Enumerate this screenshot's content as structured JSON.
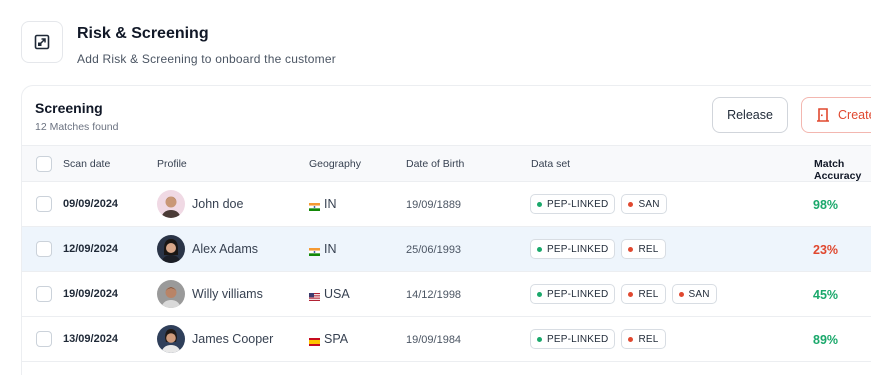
{
  "header": {
    "title": "Risk & Screening",
    "subtitle": "Add Risk & Screening to onboard the customer",
    "icon": "external-link-icon"
  },
  "screening": {
    "title": "Screening",
    "count_text": "12 Matches found",
    "release_label": "Release",
    "create_label": "Create",
    "create_icon": "door-icon",
    "accent_color": "#e0482f",
    "columns": [
      "Scan date",
      "Profile",
      "Geography",
      "Date of Birth",
      "Data set",
      "Match Accuracy"
    ],
    "rows": [
      {
        "scan_date": "09/09/2024",
        "name": "John doe",
        "geo": "IN",
        "flag": "india-flag",
        "dob": "19/09/1889",
        "datasets": [
          "PEP-LINKED",
          "SAN"
        ],
        "accuracy": "98%",
        "accuracy_status": "good",
        "selected": false
      },
      {
        "scan_date": "12/09/2024",
        "name": "Alex Adams",
        "geo": "IN",
        "flag": "india-flag",
        "dob": "25/06/1993",
        "datasets": [
          "PEP-LINKED",
          "REL"
        ],
        "accuracy": "23%",
        "accuracy_status": "bad",
        "selected": true
      },
      {
        "scan_date": "19/09/2024",
        "name": "Willy villiams",
        "geo": "USA",
        "flag": "usa-flag",
        "dob": "14/12/1998",
        "datasets": [
          "PEP-LINKED",
          "REL",
          "SAN"
        ],
        "accuracy": "45%",
        "accuracy_status": "good",
        "selected": false
      },
      {
        "scan_date": "13/09/2024",
        "name": "James Cooper",
        "geo": "SPA",
        "flag": "spain-flag",
        "dob": "19/09/1984",
        "datasets": [
          "PEP-LINKED",
          "REL"
        ],
        "accuracy": "89%",
        "accuracy_status": "good",
        "selected": false
      }
    ]
  }
}
